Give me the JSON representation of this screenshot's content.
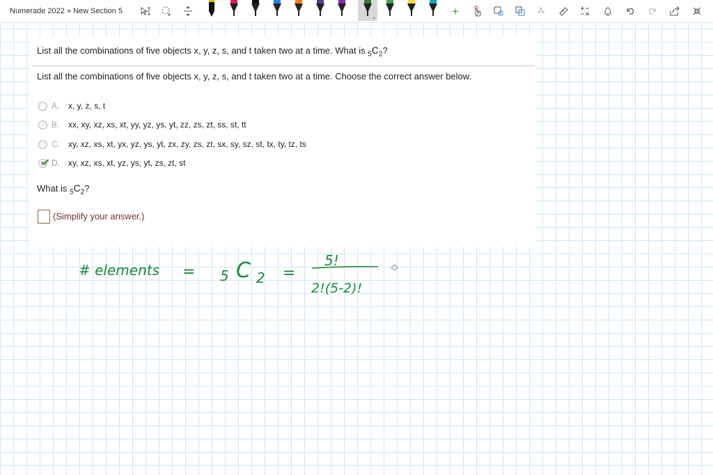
{
  "app": {
    "title": "Numerade 2022 » New Section 5"
  },
  "toolbar": {
    "icons": [
      "select-text-icon",
      "lasso-select-icon",
      "insert-space-icon",
      "pen-icon",
      "add-pen-icon",
      "ruler-icon",
      "eraser-icon",
      "shapes-icon",
      "math-icon",
      "undo-icon",
      "redo-icon",
      "share-icon",
      "collapse-icon"
    ],
    "pen_colors": [
      "#000000",
      "#d81b60",
      "#111111",
      "#1e88e5",
      "#f57c00",
      "#5e35b1",
      "#8e24aa",
      "#e91e63",
      "#2e7d32",
      "#43a047",
      "#fdd835",
      "#00acc1"
    ],
    "add_label": "+",
    "active_pen_color": "#2e7d32"
  },
  "question": {
    "header_text": "List all the combinations of five objects x, y, z, s, and t taken two at a time. What is ",
    "header_sub_n": "5",
    "header_c": "C",
    "header_sub_k": "2",
    "header_q": "?",
    "sub_text": "List all the combinations of five objects x, y, z, s, and t taken two at a time. Choose the correct answer below.",
    "options": [
      {
        "letter": "A.",
        "text": "x, y, z, s, t",
        "selected": false
      },
      {
        "letter": "B.",
        "text": "xx, xy, xz, xs, xt, yy, yz, ys, yt, zz, zs, zt, ss, st, tt",
        "selected": false
      },
      {
        "letter": "C.",
        "text": "xy, xz, xs, xt, yx, yz, ys, yt, zx, zy, zs, zt, sx, sy, sz, st, tx, ty, tz, ts",
        "selected": false
      },
      {
        "letter": "D.",
        "text": "xy, xz, xs, xt, yz, ys, yt, zs, zt, st",
        "selected": true
      }
    ],
    "what_is_text": "What is ",
    "what_is_n": "5",
    "what_is_c": "C",
    "what_is_k": "2",
    "what_is_q": "?",
    "hint": "(Simplify your answer.)"
  },
  "handwriting": {
    "color": "#1a8a3c",
    "lhs": "# elements",
    "eq1": "=",
    "n": "5",
    "c": "C",
    "k": "2",
    "eq2": "=",
    "numerator": "5!",
    "denominator": "2!(5-2)!"
  },
  "colors": {
    "grid": "#cfe6f2",
    "correct_check": "#3a9d23",
    "hint": "#7a2c2c"
  }
}
